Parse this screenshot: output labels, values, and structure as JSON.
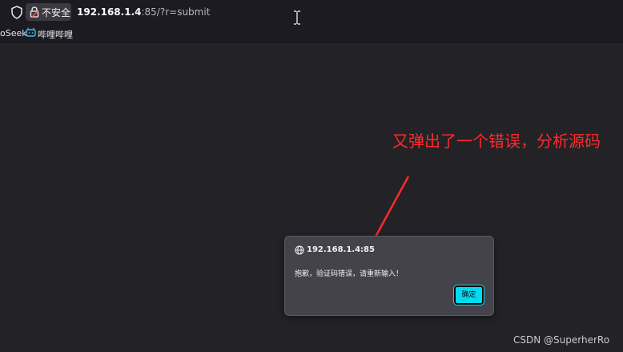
{
  "browser": {
    "security_label": "不安全",
    "url_host": "192.168.1.4",
    "url_rest": ":85/?r=submit",
    "icons": [
      "shield-icon",
      "lock-warning-icon",
      "text-cursor-icon"
    ]
  },
  "bookmarks": {
    "items": [
      {
        "label": "oSeek"
      },
      {
        "label": "哔哩哔哩",
        "icon": "bilibili-icon"
      }
    ]
  },
  "annotation": {
    "text": "又弹出了一个错误，分析源码",
    "color": "#ff2a2a"
  },
  "dialog": {
    "origin": "192.168.1.4:85",
    "message": "抱歉，验证码错误，请重新输入！",
    "ok_label": "确定",
    "accent": "#00dbf0",
    "icon": "globe-icon"
  },
  "watermark": "CSDN @SuperherRo"
}
